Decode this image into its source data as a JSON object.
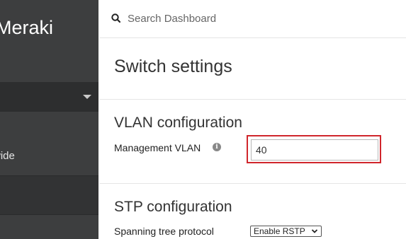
{
  "sidebar": {
    "brand": "Meraki",
    "item_label": "wide"
  },
  "header": {
    "search_placeholder": "Search Dashboard"
  },
  "main": {
    "title": "Switch settings",
    "vlan_section": {
      "title": "VLAN configuration",
      "management_vlan_label": "Management VLAN",
      "management_vlan_value": "40"
    },
    "stp_section": {
      "title": "STP configuration",
      "spanning_tree_label": "Spanning tree protocol",
      "spanning_tree_selected": "Enable RSTP"
    }
  },
  "colors": {
    "sidebar_bg": "#3d3e3f",
    "highlight": "#d0262c"
  }
}
